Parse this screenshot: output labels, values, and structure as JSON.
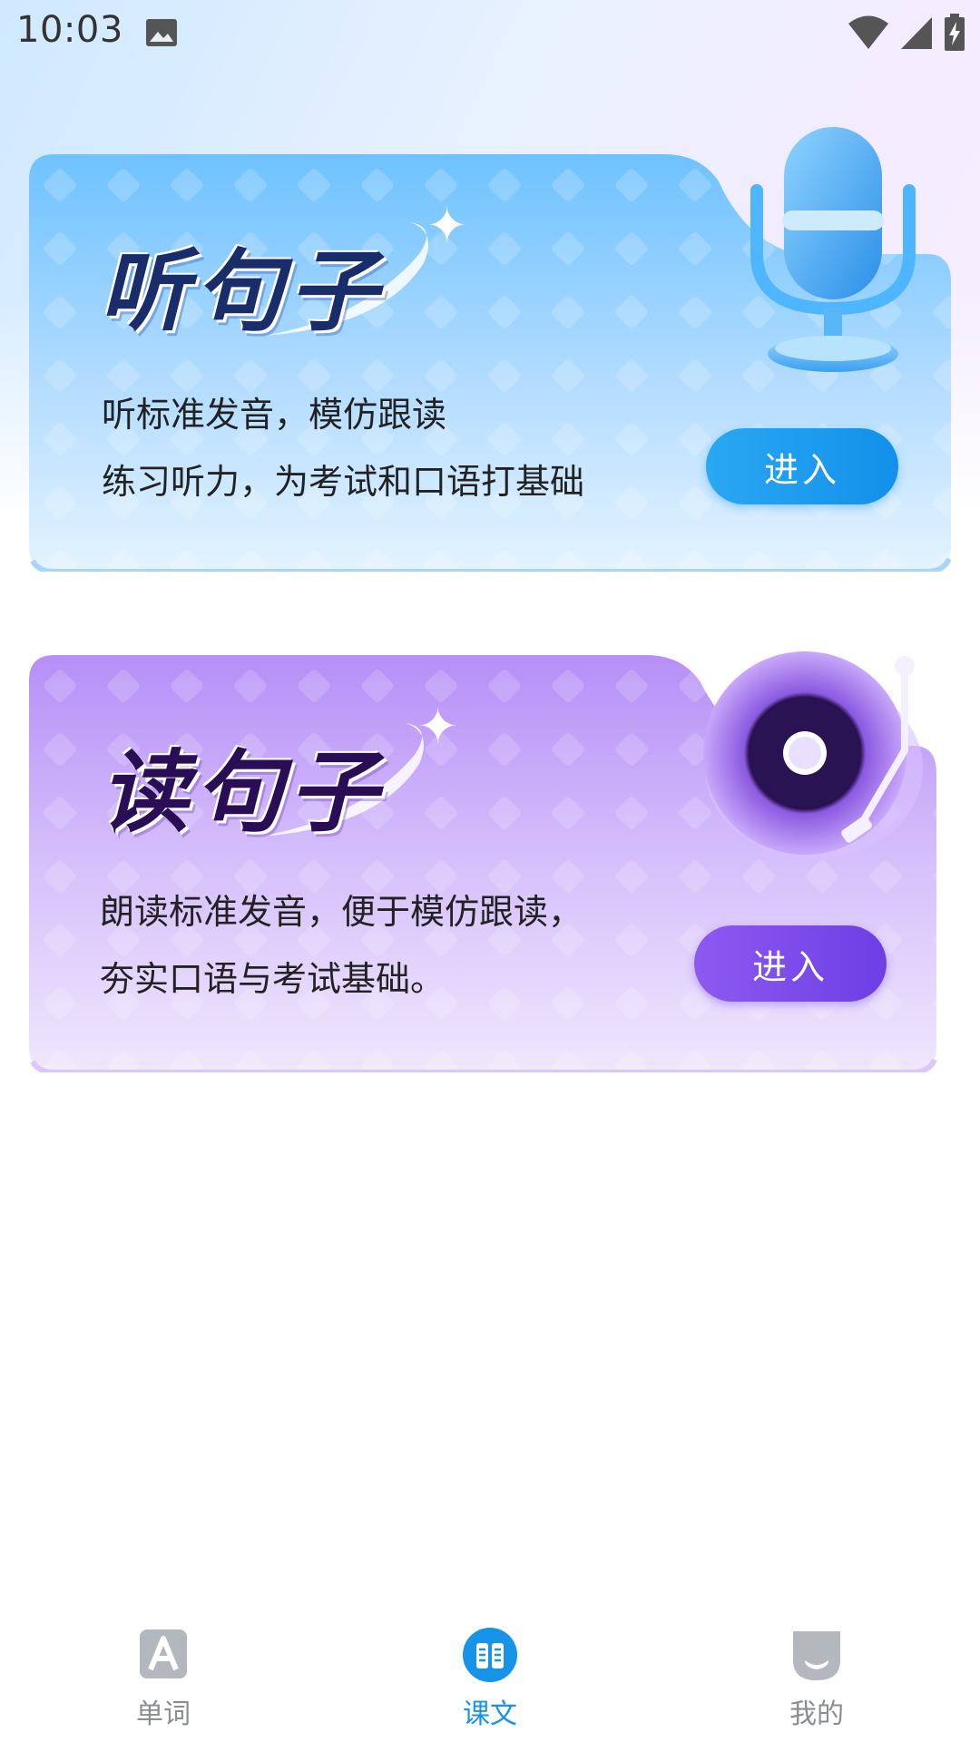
{
  "status_bar": {
    "time": "10:03",
    "icons": [
      "image-icon",
      "wifi-icon",
      "signal-icon",
      "battery-charging-icon"
    ]
  },
  "cards": [
    {
      "title": "听句子",
      "desc_lines": [
        "听标准发音，模仿跟读",
        "练习听力，为考试和口语打基础"
      ],
      "button_label": "进入",
      "illustration": "microphone-icon",
      "accent": "#1290ea"
    },
    {
      "title": "读句子",
      "desc_lines": [
        "朗读标准发音，便于模仿跟读，",
        "夯实口语与考试基础。"
      ],
      "button_label": "进入",
      "illustration": "vinyl-record-icon",
      "accent": "#6e3ee6"
    }
  ],
  "bottom_nav": {
    "items": [
      {
        "label": "单词",
        "icon": "word-a-icon",
        "active": false
      },
      {
        "label": "课文",
        "icon": "book-open-icon",
        "active": true
      },
      {
        "label": "我的",
        "icon": "profile-icon",
        "active": false
      }
    ],
    "active_color": "#1793e8",
    "inactive_color": "#8a8d94"
  }
}
